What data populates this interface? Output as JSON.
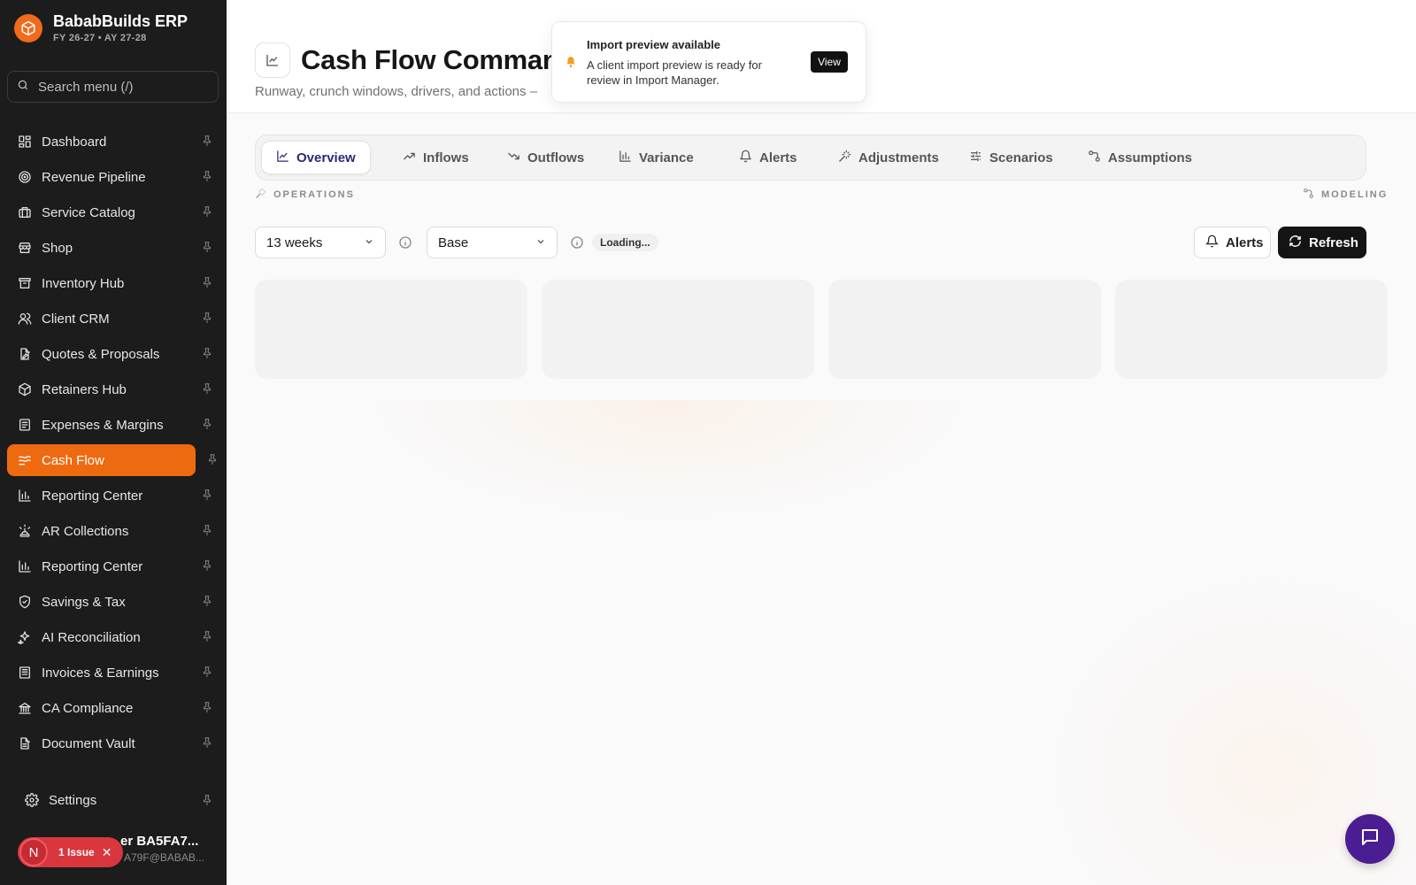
{
  "brand": {
    "name": "BababBuilds ERP",
    "period": "FY 26-27 • AY 27-28"
  },
  "search": {
    "placeholder": "Search menu (/)"
  },
  "sidebar": {
    "items": [
      {
        "label": "Dashboard",
        "icon": "dashboard-icon"
      },
      {
        "label": "Revenue Pipeline",
        "icon": "target-icon"
      },
      {
        "label": "Service Catalog",
        "icon": "briefcase-icon"
      },
      {
        "label": "Shop",
        "icon": "store-icon"
      },
      {
        "label": "Inventory Hub",
        "icon": "archive-icon"
      },
      {
        "label": "Client CRM",
        "icon": "users-icon"
      },
      {
        "label": "Quotes & Proposals",
        "icon": "file-edit-icon"
      },
      {
        "label": "Retainers Hub",
        "icon": "package-icon"
      },
      {
        "label": "Expenses & Margins",
        "icon": "receipt-icon"
      },
      {
        "label": "Cash Flow",
        "icon": "cash-flow-icon",
        "active": true
      },
      {
        "label": "Reporting Center",
        "icon": "bar-chart-icon"
      },
      {
        "label": "AR Collections",
        "icon": "alarm-icon"
      },
      {
        "label": "Reporting Center",
        "icon": "bar-chart-icon"
      },
      {
        "label": "Savings & Tax",
        "icon": "shield-icon"
      },
      {
        "label": "AI Reconciliation",
        "icon": "sparkles-icon"
      },
      {
        "label": "Invoices & Earnings",
        "icon": "invoice-icon"
      },
      {
        "label": "CA Compliance",
        "icon": "bank-icon"
      },
      {
        "label": "Document Vault",
        "icon": "document-icon"
      }
    ],
    "settings_label": "Settings",
    "active_color": "#ee6a10"
  },
  "user": {
    "name": "er BA5FA7...",
    "email": "A79F@BABAB...",
    "issue_label": "1 Issue",
    "issue_avatar": "N"
  },
  "header": {
    "title": "Cash Flow Command",
    "subtitle": "Runway, crunch windows, drivers, and actions –"
  },
  "toast": {
    "title": "Import preview available",
    "body": "A client import preview is ready for review in Import Manager.",
    "action": "View"
  },
  "tabs": [
    {
      "label": "Overview",
      "icon": "line-chart-icon",
      "active": true
    },
    {
      "label": "Inflows",
      "icon": "trending-up-icon"
    },
    {
      "label": "Outflows",
      "icon": "trending-down-icon"
    },
    {
      "label": "Variance",
      "icon": "bar-chart-icon"
    },
    {
      "label": "Alerts",
      "icon": "bell-icon"
    },
    {
      "label": "Adjustments",
      "icon": "wand-icon"
    },
    {
      "label": "Scenarios",
      "icon": "sliders-icon"
    },
    {
      "label": "Assumptions",
      "icon": "workflow-icon"
    }
  ],
  "groups": {
    "operations": "OPERATIONS",
    "modeling": "MODELING"
  },
  "controls": {
    "horizon": "13 weeks",
    "scenario": "Base",
    "status": "Loading...",
    "alerts_button": "Alerts",
    "refresh_button": "Refresh"
  }
}
